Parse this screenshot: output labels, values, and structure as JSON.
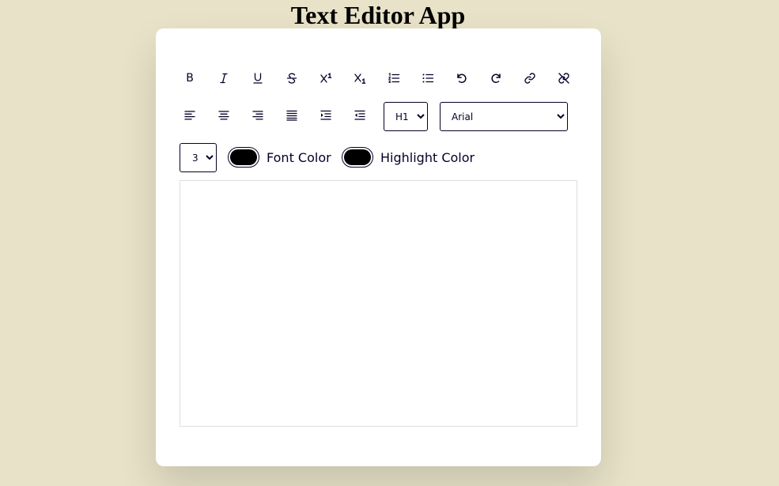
{
  "page": {
    "title": "Text Editor App"
  },
  "toolbar": {
    "row1": [
      {
        "name": "bold-button",
        "icon": "bold-icon",
        "label": "B"
      },
      {
        "name": "italic-button",
        "icon": "italic-icon"
      },
      {
        "name": "underline-button",
        "icon": "underline-icon"
      },
      {
        "name": "strikethrough-button",
        "icon": "strikethrough-icon"
      },
      {
        "name": "superscript-button",
        "icon": "superscript-icon"
      },
      {
        "name": "subscript-button",
        "icon": "subscript-icon"
      },
      {
        "name": "ordered-list-button",
        "icon": "ordered-list-icon"
      },
      {
        "name": "unordered-list-button",
        "icon": "unordered-list-icon"
      },
      {
        "name": "undo-button",
        "icon": "undo-icon"
      },
      {
        "name": "redo-button",
        "icon": "redo-icon"
      },
      {
        "name": "create-link-button",
        "icon": "link-icon"
      },
      {
        "name": "unlink-button",
        "icon": "unlink-icon"
      }
    ],
    "row2": [
      {
        "name": "align-left-button",
        "icon": "align-left-icon"
      },
      {
        "name": "align-center-button",
        "icon": "align-center-icon"
      },
      {
        "name": "align-right-button",
        "icon": "align-right-icon"
      },
      {
        "name": "justify-button",
        "icon": "align-justify-icon"
      },
      {
        "name": "indent-button",
        "icon": "indent-icon"
      },
      {
        "name": "outdent-button",
        "icon": "outdent-icon"
      }
    ],
    "heading_select": {
      "value": "H1"
    },
    "font_select": {
      "value": "Arial"
    },
    "font_size_select": {
      "value": "3"
    },
    "font_color": {
      "label": "Font Color",
      "value": "#000000"
    },
    "highlight_color": {
      "label": "Highlight Color",
      "value": "#000000"
    }
  },
  "editor": {
    "content": ""
  },
  "colors": {
    "icon": "#020229",
    "background": "#e8e2c8",
    "card": "#ffffff"
  }
}
